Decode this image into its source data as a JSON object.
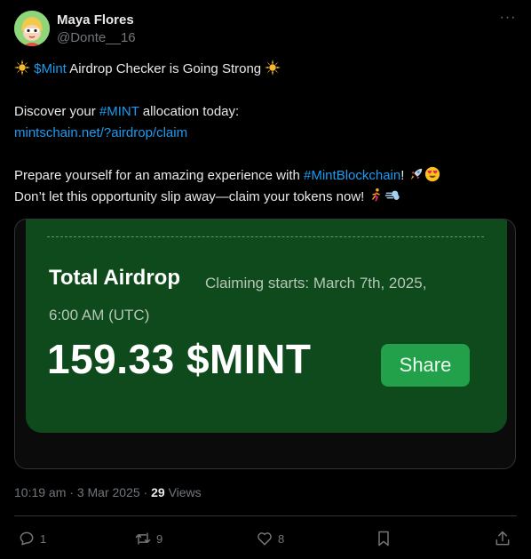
{
  "author": {
    "name": "Maya Flores",
    "handle": "@Donte__16"
  },
  "tweet": {
    "line1": {
      "cashtag": "$Mint",
      "text": " Airdrop Checker is Going Strong "
    },
    "line2": {
      "pre": "Discover your ",
      "hashtag": "#MINT",
      "post": " allocation today:"
    },
    "line3": {
      "link": "mintschain.net/?airdrop/claim"
    },
    "line4": {
      "pre": "Prepare yourself for an amazing experience with ",
      "hashtag": "#MintBlockchain",
      "post": "! "
    },
    "line5": {
      "text": "Don’t let this opportunity slip away—claim your tokens now! "
    }
  },
  "card": {
    "title": "Total Airdrop",
    "claim_line1": "Claiming starts: March 7th, 2025,",
    "claim_line2": "6:00 AM (UTC)",
    "amount": "159.33 $MINT",
    "share_label": "Share"
  },
  "meta": {
    "time": "10:19 am",
    "sep1": " · ",
    "date": "3 Mar 2025",
    "sep2": " · ",
    "views_count": "29",
    "views_label": " Views"
  },
  "actions": {
    "reply_count": "1",
    "retweet_count": "9",
    "like_count": "8"
  },
  "colors": {
    "accent": "#1d9bf0",
    "card_bg": "#0f4a1d",
    "share_bg": "#22a04a"
  }
}
